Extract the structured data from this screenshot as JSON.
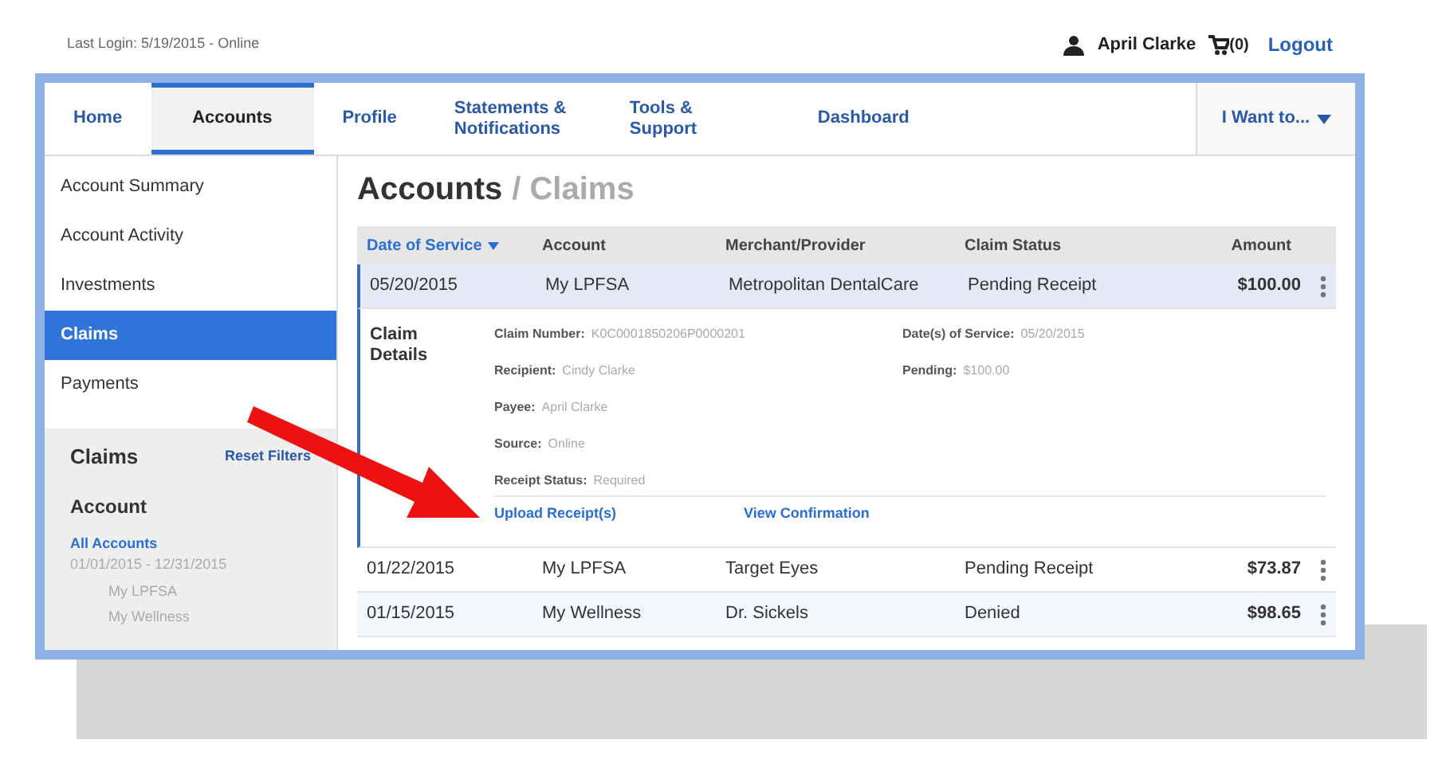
{
  "top_bar": {
    "last_login": "Last Login: 5/19/2015 - Online",
    "user": "April Clarke",
    "cart": "(0)",
    "logout": "Logout"
  },
  "nav": {
    "tabs": [
      {
        "label": "Home",
        "selected": false
      },
      {
        "label": "Accounts",
        "selected": true
      },
      {
        "label": "Profile",
        "selected": false
      },
      {
        "label": "Statements & Notifications",
        "selected": false
      },
      {
        "label": "Tools & Support",
        "selected": false
      },
      {
        "label": "Dashboard",
        "selected": false
      }
    ],
    "menu": "I Want to..."
  },
  "sidebar": {
    "items": [
      {
        "label": "Account Summary",
        "selected": false
      },
      {
        "label": "Account Activity",
        "selected": false
      },
      {
        "label": "Investments",
        "selected": false
      },
      {
        "label": "Claims",
        "selected": true
      },
      {
        "label": "Payments",
        "selected": false
      }
    ],
    "filters": {
      "title": "Claims",
      "reset": "Reset Filters",
      "heading": "Account",
      "options": [
        {
          "label": "All Accounts",
          "selected": true,
          "period": "01/01/2015 - 12/31/2015",
          "children": [
            {
              "label": "My LPFSA",
              "selected": false
            },
            {
              "label": "My Wellness",
              "selected": false
            }
          ]
        }
      ]
    }
  },
  "main": {
    "title": "Accounts",
    "subtitle": "/ Claims",
    "table": {
      "columns": [
        {
          "label": "Date of Service",
          "sorted": true
        },
        {
          "label": "Account",
          "sorted": false
        },
        {
          "label": "Merchant/Provider",
          "sorted": false
        },
        {
          "label": "Claim Status",
          "sorted": false
        },
        {
          "label": "Amount",
          "sorted": false
        }
      ],
      "rows": [
        {
          "cells": [
            "05/20/2015",
            "My LPFSA",
            "Metropolitan DentalCare",
            "Pending Receipt",
            "$100.00"
          ],
          "selected": true
        },
        {
          "cells": [
            "01/22/2015",
            "My LPFSA",
            "Target Eyes",
            "Pending Receipt",
            "$73.87"
          ],
          "selected": false
        },
        {
          "cells": [
            "01/15/2015",
            "My Wellness",
            "Dr. Sickels",
            "Denied",
            "$98.65"
          ],
          "selected": false
        }
      ]
    },
    "details": {
      "title": "Claim Details",
      "left_fields": [
        {
          "label": "Claim Number:",
          "value": "K0C0001850206P0000201"
        },
        {
          "label": "Recipient:",
          "value": "Cindy Clarke"
        },
        {
          "label": "Payee:",
          "value": "April Clarke"
        },
        {
          "label": "Source:",
          "value": "Online"
        },
        {
          "label": "Receipt Status:",
          "value": "Required"
        }
      ],
      "right_fields": [
        {
          "label": "Date(s) of Service:",
          "value": "05/20/2015"
        },
        {
          "label": "Pending:",
          "value": "$100.00"
        }
      ],
      "links": [
        "Upload Receipt(s)",
        "View Confirmation"
      ]
    }
  }
}
